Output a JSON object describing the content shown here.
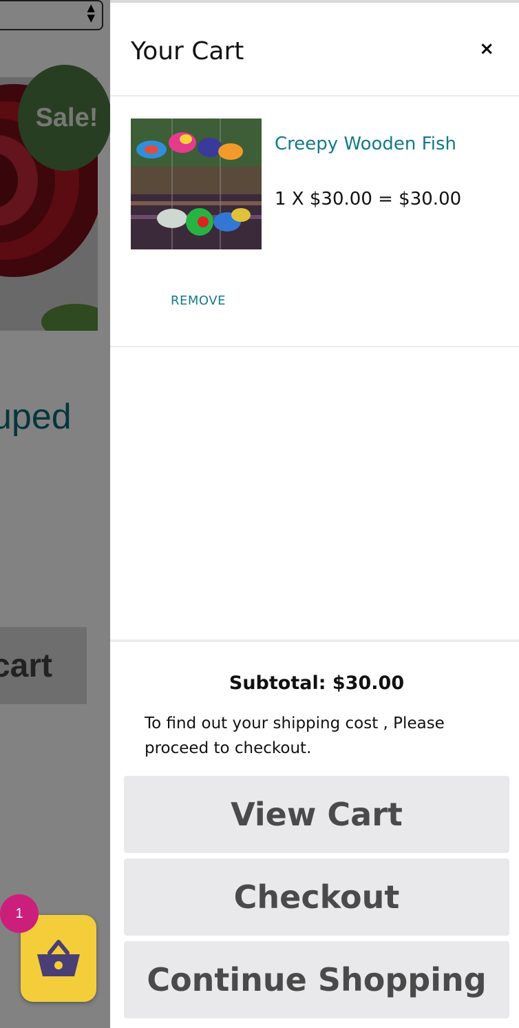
{
  "background": {
    "sale_badge": "Sale!",
    "product_title_fragment": "uped",
    "add_to_cart_fragment": "cart",
    "select_icon": "updown-arrows-icon"
  },
  "cart": {
    "title": "Your Cart",
    "close_label": "×",
    "items": [
      {
        "name": "Creepy Wooden Fish",
        "quantity_line": "1 X $30.00 = $30.00",
        "remove_label": "REMOVE",
        "thumbnail": "wooden-fish-photo"
      }
    ],
    "subtotal_label": "Subtotal:",
    "subtotal_value": "$30.00",
    "shipping_note": "To find out your shipping cost , Please proceed to checkout.",
    "buttons": {
      "view_cart": "View Cart",
      "checkout": "Checkout",
      "continue_shopping": "Continue Shopping"
    }
  },
  "basket": {
    "count": "1",
    "icon": "basket-icon"
  },
  "colors": {
    "accent_teal": "#117a8b",
    "sale_green": "#4e7b43",
    "basket_yellow": "#f4cd3b",
    "badge_magenta": "#cc1f7c",
    "button_gray": "#e9e8eb"
  }
}
